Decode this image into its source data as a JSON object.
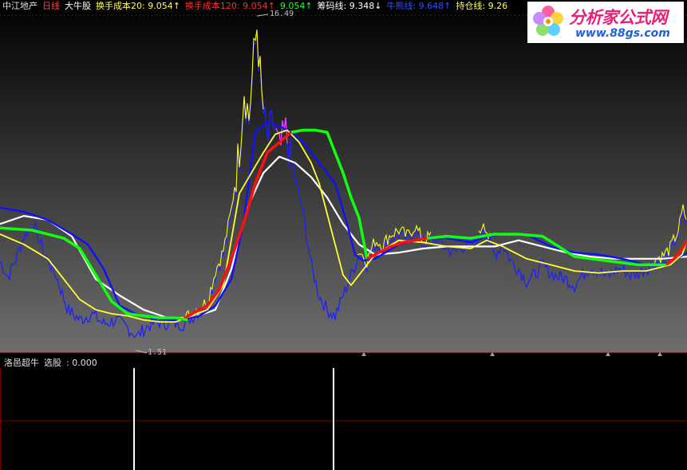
{
  "top_legend": {
    "stock_name": "中江地产",
    "period": "日线",
    "indicator": "大牛股",
    "items": [
      {
        "label": "换手成本20",
        "value": ": 9.054",
        "arrow": "↑",
        "color": "#ffff66"
      },
      {
        "label": "换手成本120",
        "value": ": 9.054",
        "arrow": "↑",
        "color": "#ff3030"
      },
      {
        "label": "",
        "value": "9.054",
        "arrow": "↑",
        "color": "#30ff30"
      },
      {
        "label": "筹码线",
        "value": ": 9.348",
        "arrow": "↓",
        "color": "#ffffff"
      },
      {
        "label": "牛熊线",
        "value": ": 9.648",
        "arrow": "↑",
        "color": "#3050ff"
      },
      {
        "label": "持仓线",
        "value": ": 9.26",
        "arrow": "",
        "color": "#ffff66"
      }
    ]
  },
  "bottom_legend": {
    "indicator": "洛邑超牛",
    "label": "选股",
    "value": ": 0.000"
  },
  "logo": {
    "title": "分析家公式网",
    "url": "www.88gs.com"
  },
  "colors": {
    "price": "#2020ff",
    "price_up": "#ffff00",
    "price_bear": "#ff40ff",
    "cost20": "#ffff33",
    "cost120_red": "#ff1010",
    "cost120_green": "#10ff10",
    "chip": "#ffffff",
    "bull_bear": "#1010ff",
    "signal": "#ffffff",
    "divider": "#800000"
  },
  "chart_data": {
    "type": "line",
    "main_pane": {
      "ylim": [
        0.8,
        17.2
      ],
      "x_count": 861,
      "annotations": {
        "high_label": "16.49",
        "low_label": "1.51"
      },
      "series": [
        {
          "key": "price",
          "x": [
            0,
            10,
            20,
            30,
            42,
            55,
            70,
            85,
            100,
            115,
            130,
            145,
            160,
            172,
            185,
            200,
            215,
            230,
            245,
            260,
            270,
            280,
            290,
            300,
            306,
            312,
            318,
            322,
            328,
            335,
            342,
            350,
            358,
            365,
            372,
            380,
            390,
            400,
            410,
            420,
            430,
            440,
            450,
            460,
            470,
            480,
            490,
            500,
            510,
            520,
            530,
            540,
            550,
            560,
            570,
            580,
            590,
            600,
            606,
            612,
            620,
            630,
            640,
            650,
            660,
            670,
            680,
            690,
            700,
            710,
            720,
            730,
            740,
            750,
            760,
            770,
            780,
            790,
            800,
            810,
            820,
            830,
            840,
            850,
            856,
            861
          ],
          "y": [
            5.2,
            4.4,
            5.3,
            6.4,
            7.0,
            5.6,
            4.5,
            2.8,
            2.3,
            2.6,
            2.1,
            2.3,
            1.9,
            1.5,
            2.0,
            2.2,
            2.1,
            2.1,
            2.6,
            3.0,
            4.5,
            5.5,
            7.5,
            10.5,
            13.5,
            12.0,
            15.0,
            16.5,
            13.0,
            11.0,
            12.0,
            10.5,
            11.5,
            10.0,
            9.0,
            7.5,
            5.0,
            3.5,
            2.8,
            2.5,
            3.5,
            4.5,
            5.5,
            5.0,
            6.0,
            5.8,
            6.3,
            6.5,
            6.2,
            6.7,
            6.0,
            6.2,
            6.1,
            5.8,
            5.6,
            5.9,
            6.0,
            6.2,
            7.0,
            6.2,
            5.5,
            6.0,
            5.2,
            4.8,
            4.2,
            4.5,
            5.0,
            4.6,
            4.4,
            4.3,
            4.0,
            4.5,
            4.9,
            4.7,
            4.4,
            4.7,
            4.8,
            4.5,
            4.6,
            4.8,
            5.1,
            5.2,
            5.6,
            6.5,
            7.5,
            7.0
          ]
        },
        {
          "key": "chip",
          "x": [
            0,
            30,
            60,
            90,
            120,
            150,
            180,
            210,
            240,
            270,
            290,
            310,
            330,
            350,
            370,
            390,
            410,
            430,
            450,
            470,
            500,
            530,
            560,
            590,
            620,
            650,
            680,
            710,
            740,
            770,
            800,
            830,
            861
          ],
          "y": [
            7.0,
            7.4,
            7.2,
            6.4,
            4.3,
            3.5,
            2.8,
            2.4,
            2.4,
            2.8,
            4.8,
            7.8,
            9.5,
            10.3,
            10.0,
            9.3,
            8.3,
            7.0,
            6.0,
            5.5,
            5.6,
            5.8,
            5.9,
            5.9,
            5.9,
            6.2,
            5.9,
            5.6,
            5.4,
            5.3,
            5.3,
            5.3,
            5.4
          ]
        },
        {
          "key": "bull_bear",
          "x": [
            0,
            30,
            60,
            90,
            110,
            130,
            150,
            170,
            190,
            210,
            230,
            250,
            270,
            290,
            305,
            320,
            335,
            350,
            365,
            380,
            400,
            420,
            435,
            445,
            455,
            470,
            500,
            530,
            560,
            590,
            610,
            630,
            660,
            690,
            720,
            750,
            780,
            810,
            840,
            861
          ],
          "y": [
            7.8,
            7.6,
            7.2,
            6.5,
            6.0,
            4.8,
            3.0,
            2.6,
            2.4,
            2.3,
            2.3,
            2.5,
            3.0,
            4.3,
            7.0,
            11.5,
            12.0,
            11.8,
            11.5,
            11.0,
            10.0,
            9.0,
            7.0,
            5.5,
            5.2,
            5.3,
            6.0,
            6.3,
            6.3,
            6.1,
            6.4,
            6.5,
            6.5,
            5.9,
            5.6,
            5.5,
            5.3,
            5.0,
            5.1,
            5.6
          ]
        },
        {
          "key": "cost20",
          "x": [
            0,
            30,
            60,
            80,
            100,
            120,
            140,
            160,
            180,
            200,
            220,
            240,
            260,
            280,
            300,
            315,
            330,
            345,
            360,
            375,
            390,
            400,
            410,
            420,
            430,
            440,
            450,
            470,
            500,
            530,
            560,
            590,
            610,
            630,
            660,
            690,
            720,
            750,
            780,
            810,
            840,
            855,
            861
          ],
          "y": [
            6.5,
            6.0,
            5.3,
            4.3,
            3.3,
            2.8,
            2.6,
            2.5,
            2.3,
            2.2,
            2.2,
            2.5,
            2.8,
            4.0,
            8.5,
            9.5,
            10.5,
            11.4,
            11.6,
            11.0,
            10.0,
            9.0,
            7.5,
            6.0,
            4.5,
            4.0,
            4.5,
            5.5,
            6.2,
            6.1,
            5.9,
            5.8,
            6.2,
            5.9,
            5.3,
            5.0,
            4.7,
            4.6,
            4.7,
            4.7,
            5.0,
            5.5,
            6.2
          ]
        },
        {
          "key": "cost120_red",
          "x": [
            228,
            245,
            260,
            275,
            290,
            305,
            320,
            335,
            350,
            365
          ],
          "y": [
            2.3,
            2.7,
            3.0,
            3.8,
            5.3,
            7.0,
            9.0,
            10.5,
            11.0,
            11.5
          ]
        },
        {
          "key": "cost120_green",
          "x": [
            0,
            40,
            80,
            100,
            120,
            140,
            160,
            180,
            200,
            220,
            235
          ],
          "y": [
            6.8,
            6.7,
            6.3,
            5.8,
            4.5,
            3.2,
            2.6,
            2.5,
            2.4,
            2.4,
            2.3
          ]
        },
        {
          "key": "cost120_green",
          "x": [
            365,
            380,
            395,
            410,
            420,
            430,
            440,
            450,
            460
          ],
          "y": [
            11.5,
            11.6,
            11.6,
            11.5,
            10.5,
            9.5,
            8.3,
            7.3,
            5.3
          ]
        },
        {
          "key": "cost120_red",
          "x": [
            460,
            475,
            490,
            505,
            520,
            535
          ],
          "y": [
            5.3,
            5.6,
            5.9,
            6.1,
            6.2,
            6.3
          ]
        },
        {
          "key": "cost120_green",
          "x": [
            535,
            560,
            590,
            620,
            650,
            680,
            700,
            720,
            740,
            760,
            780,
            800,
            820,
            835
          ],
          "y": [
            6.3,
            6.4,
            6.3,
            6.5,
            6.5,
            6.4,
            5.9,
            5.4,
            5.3,
            5.2,
            5.1,
            5.0,
            5.0,
            5.0
          ]
        },
        {
          "key": "cost120_red",
          "x": [
            835,
            845,
            855,
            861
          ],
          "y": [
            5.0,
            5.3,
            5.8,
            6.2
          ]
        }
      ]
    },
    "sub_pane": {
      "label": "选股",
      "signals_x": [
        168,
        418
      ]
    },
    "markers_x": [
      456,
      617,
      762,
      827
    ]
  }
}
